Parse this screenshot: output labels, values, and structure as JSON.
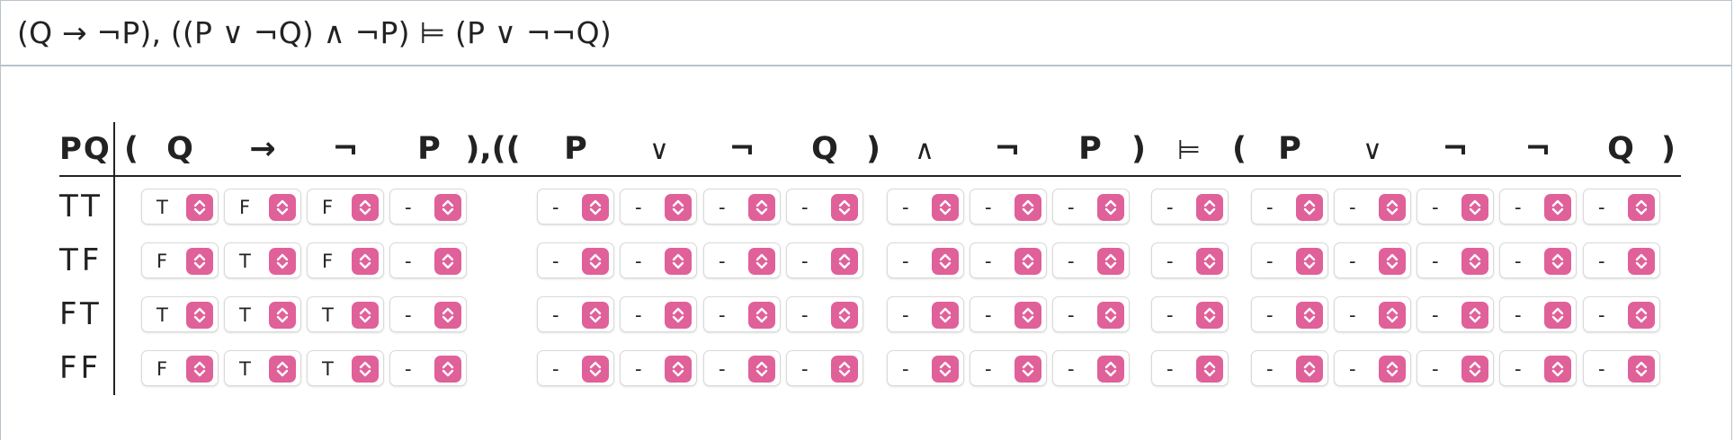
{
  "formula": "(Q → ¬P), ((P ∨ ¬Q) ∧ ¬P) ⊨ (P ∨ ¬¬Q)",
  "header": {
    "vars": "PQ",
    "symbols": [
      "(",
      "Q",
      "→",
      "¬",
      "P",
      "),((",
      "P",
      "∨",
      "¬",
      "Q",
      ")",
      "∧",
      "¬",
      "P",
      ")",
      "⊨",
      "(",
      "P",
      "∨",
      "¬",
      "¬",
      "Q",
      ")"
    ]
  },
  "rows": [
    {
      "label": "TT",
      "values": [
        "T",
        "F",
        "F",
        "-",
        "-",
        "-",
        "-",
        "-",
        "-",
        "-",
        "-",
        "-",
        "-",
        "-",
        "-",
        "-",
        "-"
      ]
    },
    {
      "label": "TF",
      "values": [
        "F",
        "T",
        "F",
        "-",
        "-",
        "-",
        "-",
        "-",
        "-",
        "-",
        "-",
        "-",
        "-",
        "-",
        "-",
        "-",
        "-"
      ]
    },
    {
      "label": "FT",
      "values": [
        "T",
        "T",
        "T",
        "-",
        "-",
        "-",
        "-",
        "-",
        "-",
        "-",
        "-",
        "-",
        "-",
        "-",
        "-",
        "-",
        "-"
      ]
    },
    {
      "label": "FF",
      "values": [
        "F",
        "T",
        "T",
        "-",
        "-",
        "-",
        "-",
        "-",
        "-",
        "-",
        "-",
        "-",
        "-",
        "-",
        "-",
        "-",
        "-"
      ]
    }
  ],
  "colors": {
    "accent": "#e0609a",
    "border": "#b9c3cc"
  },
  "icons": {
    "select_toggle": "chevron-up-down-icon"
  }
}
